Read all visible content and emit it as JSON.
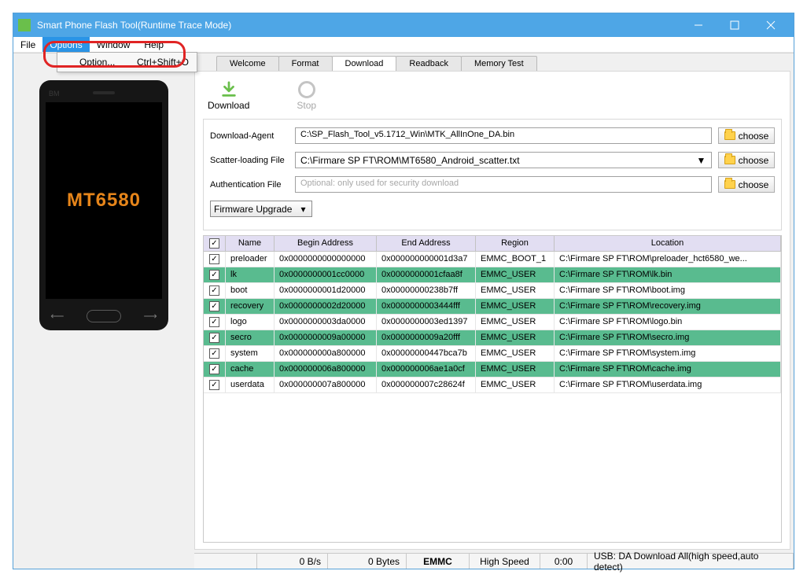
{
  "window": {
    "title": "Smart Phone Flash Tool(Runtime Trace Mode)"
  },
  "menubar": {
    "file": "File",
    "options": "Options",
    "window": "Window",
    "help": "Help"
  },
  "dropdown": {
    "option": "Option...",
    "shortcut": "Ctrl+Shift+O"
  },
  "phone": {
    "brand": "BM",
    "screen_text": "MT6580"
  },
  "tabs": {
    "welcome": "Welcome",
    "format": "Format",
    "download": "Download",
    "readback": "Readback",
    "memory_test": "Memory Test"
  },
  "toolbar": {
    "download": "Download",
    "stop": "Stop"
  },
  "form": {
    "download_agent_label": "Download-Agent",
    "download_agent_value": "C:\\SP_Flash_Tool_v5.1712_Win\\MTK_AllInOne_DA.bin",
    "scatter_label": "Scatter-loading File",
    "scatter_value": "C:\\Firmare SP FT\\ROM\\MT6580_Android_scatter.txt",
    "auth_label": "Authentication File",
    "auth_placeholder": "Optional: only used for security download",
    "choose": "choose",
    "mode": "Firmware Upgrade"
  },
  "grid": {
    "headers": {
      "name": "Name",
      "begin": "Begin Address",
      "end": "End Address",
      "region": "Region",
      "location": "Location"
    },
    "rows": [
      {
        "hl": false,
        "name": "preloader",
        "begin": "0x0000000000000000",
        "end": "0x000000000001d3a7",
        "region": "EMMC_BOOT_1",
        "location": "C:\\Firmare SP FT\\ROM\\preloader_hct6580_we..."
      },
      {
        "hl": true,
        "name": "lk",
        "begin": "0x0000000001cc0000",
        "end": "0x0000000001cfaa8f",
        "region": "EMMC_USER",
        "location": "C:\\Firmare SP FT\\ROM\\lk.bin"
      },
      {
        "hl": false,
        "name": "boot",
        "begin": "0x0000000001d20000",
        "end": "0x00000000238b7ff",
        "region": "EMMC_USER",
        "location": "C:\\Firmare SP FT\\ROM\\boot.img"
      },
      {
        "hl": true,
        "name": "recovery",
        "begin": "0x0000000002d20000",
        "end": "0x0000000003444fff",
        "region": "EMMC_USER",
        "location": "C:\\Firmare SP FT\\ROM\\recovery.img"
      },
      {
        "hl": false,
        "name": "logo",
        "begin": "0x0000000003da0000",
        "end": "0x0000000003ed1397",
        "region": "EMMC_USER",
        "location": "C:\\Firmare SP FT\\ROM\\logo.bin"
      },
      {
        "hl": true,
        "name": "secro",
        "begin": "0x0000000009a00000",
        "end": "0x0000000009a20fff",
        "region": "EMMC_USER",
        "location": "C:\\Firmare SP FT\\ROM\\secro.img"
      },
      {
        "hl": false,
        "name": "system",
        "begin": "0x000000000a800000",
        "end": "0x00000000447bca7b",
        "region": "EMMC_USER",
        "location": "C:\\Firmare SP FT\\ROM\\system.img"
      },
      {
        "hl": true,
        "name": "cache",
        "begin": "0x000000006a800000",
        "end": "0x000000006ae1a0cf",
        "region": "EMMC_USER",
        "location": "C:\\Firmare SP FT\\ROM\\cache.img"
      },
      {
        "hl": false,
        "name": "userdata",
        "begin": "0x000000007a800000",
        "end": "0x000000007c28624f",
        "region": "EMMC_USER",
        "location": "C:\\Firmare SP FT\\ROM\\userdata.img"
      }
    ]
  },
  "status": {
    "speed": "0 B/s",
    "bytes": "0 Bytes",
    "storage": "EMMC",
    "speed_mode": "High Speed",
    "time": "0:00",
    "usb": "USB: DA Download All(high speed,auto detect)"
  }
}
